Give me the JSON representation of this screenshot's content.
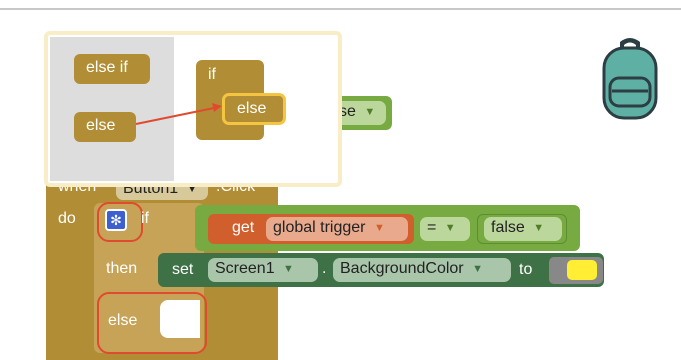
{
  "workspace": {
    "event": {
      "when_label": "when",
      "component": "Button1",
      "event_name": ".Click",
      "do_label": "do"
    },
    "if_block": {
      "if_label": "if",
      "then_label": "then",
      "else_label": "else"
    },
    "condition": {
      "get_label": "get",
      "variable": "global trigger",
      "operator": "=",
      "value": "false"
    },
    "setter": {
      "set_label": "set",
      "component": "Screen1",
      "dot": ".",
      "property": "BackgroundColor",
      "to_label": "to",
      "color": "#ffee33"
    },
    "partial_dropdown": "se",
    "backpack_icon": "backpack-icon"
  },
  "mutator": {
    "palette": [
      "else if",
      "else"
    ],
    "preview_if": "if",
    "preview_else": "else"
  },
  "colors": {
    "control": "#b18e35",
    "logic": "#77ab41",
    "variable": "#d05f2d",
    "component": "#3f7146",
    "highlight": "#f5c542",
    "annotation": "#e04a2e",
    "backpack": "#5fb0a4"
  }
}
